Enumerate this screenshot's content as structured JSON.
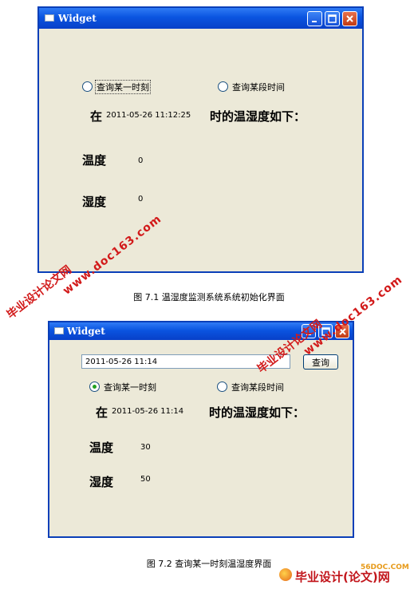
{
  "fig1": {
    "window_title": "Widget",
    "radio_point": "查询某一时刻",
    "radio_range": "查询某段时间",
    "at": "在",
    "timestamp": "2011-05-26  11:12:25",
    "result_suffix": "时的温湿度如下：",
    "temp_label": "温度",
    "temp_value": "0",
    "humidity_label": "湿度",
    "humidity_value": "0",
    "caption": "图 7.1  温湿度监测系统系统初始化界面"
  },
  "fig2": {
    "window_title": "Widget",
    "time_input_value": "2011-05-26  11:14",
    "query_button": "查询",
    "radio_point": "查询某一时刻",
    "radio_point_selected": true,
    "radio_range": "查询某段时间",
    "at": "在",
    "timestamp": "2011-05-26  11:14",
    "result_suffix": "时的温湿度如下：",
    "temp_label": "温度",
    "temp_value": "30",
    "humidity_label": "湿度",
    "humidity_value": "50",
    "caption": "图 7.2  查询某一时刻温湿度界面"
  },
  "watermarks": {
    "site_cn": "毕业设计论文网",
    "url": "www.doc163.com",
    "brand_cn": "毕业设计(论文)网",
    "brand_site": "56DOC.COM"
  },
  "colors": {
    "titlebar": "#0a54e0",
    "window_bg": "#ece9d8",
    "watermark": "#d21a1a",
    "radio_selected": "#21a121"
  }
}
